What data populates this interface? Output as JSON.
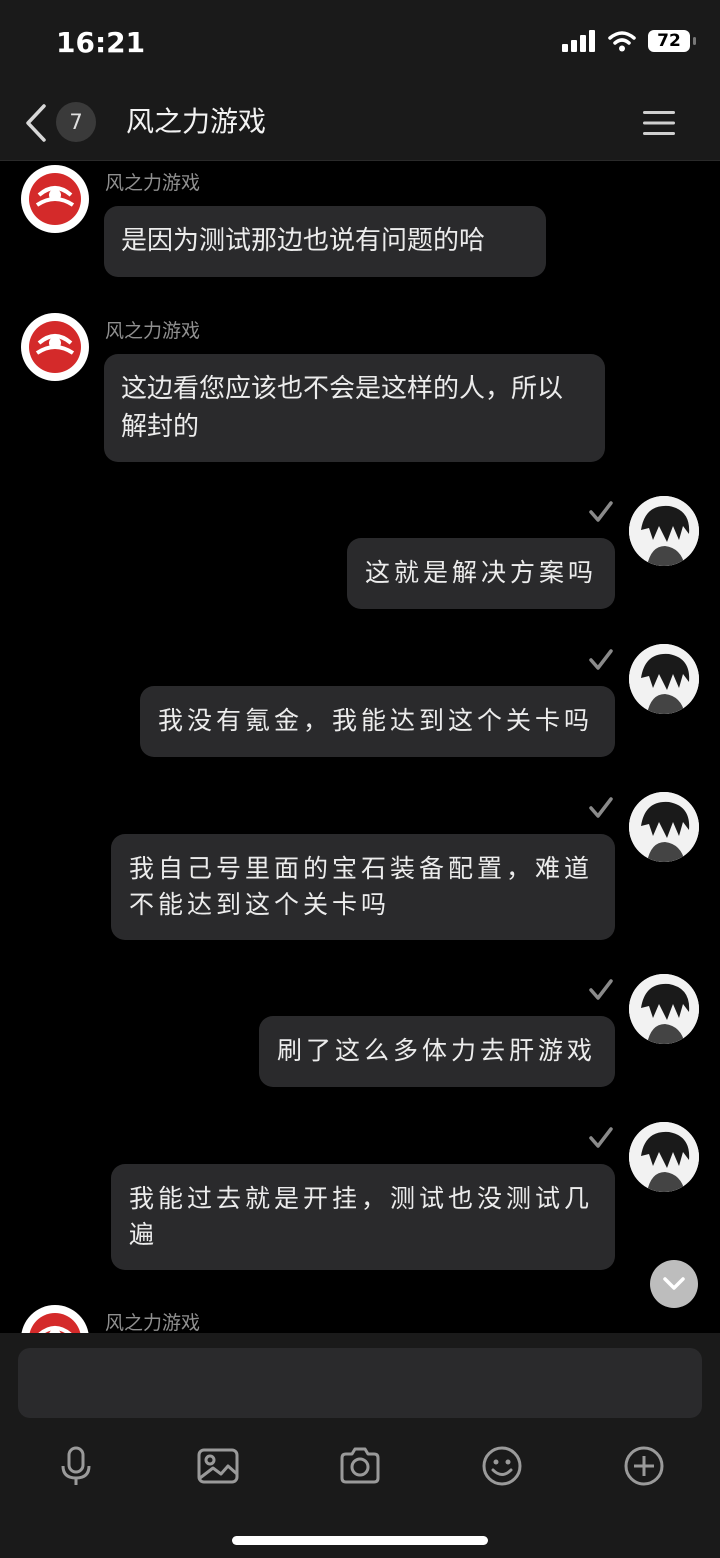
{
  "status_bar": {
    "time": "16:21",
    "battery": "72"
  },
  "header": {
    "unread_count": "7",
    "title": "风之力游戏"
  },
  "messages": [
    {
      "sender": "风之力游戏",
      "text": "是因为测试那边也说有问题的哈"
    },
    {
      "sender": "风之力游戏",
      "text": "这边看您应该也不会是这样的人，所以解封的"
    },
    {
      "text": "这就是解决方案吗"
    },
    {
      "text": "我没有氪金，我能达到这个关卡吗"
    },
    {
      "text": "我自己号里面的宝石装备配置，难道不能达到这个关卡吗"
    },
    {
      "text": "刷了这么多体力去肝游戏"
    },
    {
      "text": "我能过去就是开挂，测试也没测试几遍"
    },
    {
      "sender": "风之力游戏"
    }
  ],
  "colors": {
    "brand_red": "#d42a2a",
    "bubble": "#2a2a2c",
    "background": "#000000",
    "bar": "#1a1a1a"
  }
}
